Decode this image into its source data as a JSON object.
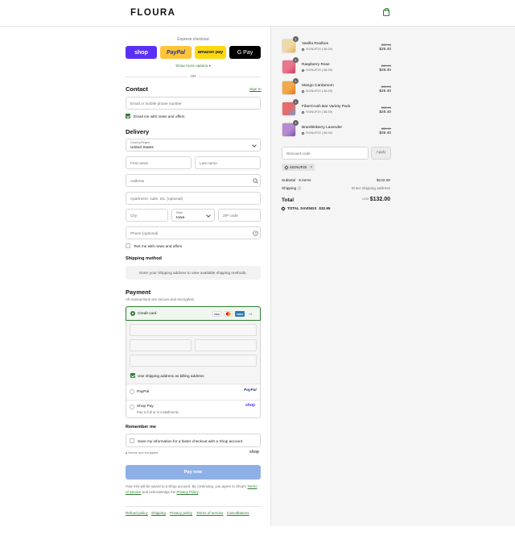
{
  "header": {
    "logo": "FLOURA"
  },
  "express": {
    "label": "Express checkout",
    "shop": "shop",
    "paypal": "PayPal",
    "amazon": "amazon pay",
    "gpay": "G Pay",
    "show_more": "Show more options",
    "or": "OR"
  },
  "contact": {
    "title": "Contact",
    "sign_in": "Sign in",
    "email_placeholder": "Email or mobile phone number",
    "news_label": "Email me with news and offers"
  },
  "delivery": {
    "title": "Delivery",
    "country_label": "Country/Region",
    "country_value": "United States",
    "first_name": "First name",
    "last_name": "Last name",
    "address": "Address",
    "apartment": "Apartment, suite, etc. (optional)",
    "city": "City",
    "state_label": "State",
    "state_value": "Iowa",
    "zip": "ZIP code",
    "phone": "Phone (optional)",
    "text_label": "Text me with news and offers"
  },
  "shipping": {
    "title": "Shipping method",
    "info": "Enter your shipping address to view available shipping methods."
  },
  "payment": {
    "title": "Payment",
    "subtitle": "All transactions are secure and encrypted.",
    "credit_card": "Credit card",
    "card_brands": [
      "VISA",
      "MC",
      "AMEX",
      "+4"
    ],
    "billing_label": "Use shipping address as billing address",
    "paypal": "PayPal",
    "paypal_logo": "PayPal",
    "shop_pay": "Shop Pay",
    "shop_pay_sub": "Pay in full or in installments",
    "shop_logo": "shop"
  },
  "remember": {
    "title": "Remember me",
    "save_label": "Save my information for a faster checkout with a Shop account",
    "secure": "Secure and encrypted",
    "shop_logo": "shop"
  },
  "pay_now": "Pay now",
  "legal": {
    "line1": "Your info will be saved to a Shop account. By continuing, you agree to Shop's",
    "terms": "Terms of Service",
    "and": "and acknowledge the",
    "privacy": "Privacy Policy",
    "end": "."
  },
  "footer": [
    "Refund policy",
    "Shipping",
    "Privacy policy",
    "Terms of service",
    "Cancellations"
  ],
  "order": {
    "items": [
      {
        "name": "Vanilla Rooibos",
        "qty": "1",
        "discount": "SIGNUP20 (-$6.59)",
        "original": "$32.99",
        "price": "$26.40",
        "color": "#f0d9a8",
        "accent": "#e8b24a"
      },
      {
        "name": "Raspberry Rose",
        "qty": "1",
        "discount": "SIGNUP20 (-$6.59)",
        "original": "$32.99",
        "price": "$26.40",
        "color": "#e9758f",
        "accent": "#c93a5f"
      },
      {
        "name": "Mango Cardamom",
        "qty": "1",
        "discount": "SIGNUP20 (-$6.59)",
        "original": "$32.99",
        "price": "$26.40",
        "color": "#f4a64a",
        "accent": "#e07b1f"
      },
      {
        "name": "FiberCrush Bar Variety Pack",
        "qty": "1",
        "discount": "SIGNUP20 (-$6.59)",
        "original": "$32.99",
        "price": "$26.40",
        "color": "#e66b6b",
        "accent": "#6aa0d8"
      },
      {
        "name": "Brambleberry Lavender",
        "qty": "1",
        "discount": "SIGNUP20 (-$6.59)",
        "original": "$32.99",
        "price": "$26.40",
        "color": "#b58ad1",
        "accent": "#7d4fa8"
      }
    ],
    "discount_placeholder": "Discount code",
    "apply": "Apply",
    "code_tag": "SIGNUP20",
    "subtotal_label": "Subtotal · 5 items",
    "subtotal_value": "$132.00",
    "shipping_label": "Shipping",
    "shipping_value": "Enter shipping address",
    "total_label": "Total",
    "currency": "USD",
    "total_value": "$132.00",
    "savings_label": "TOTAL SAVINGS",
    "savings_value": "$32.95"
  }
}
